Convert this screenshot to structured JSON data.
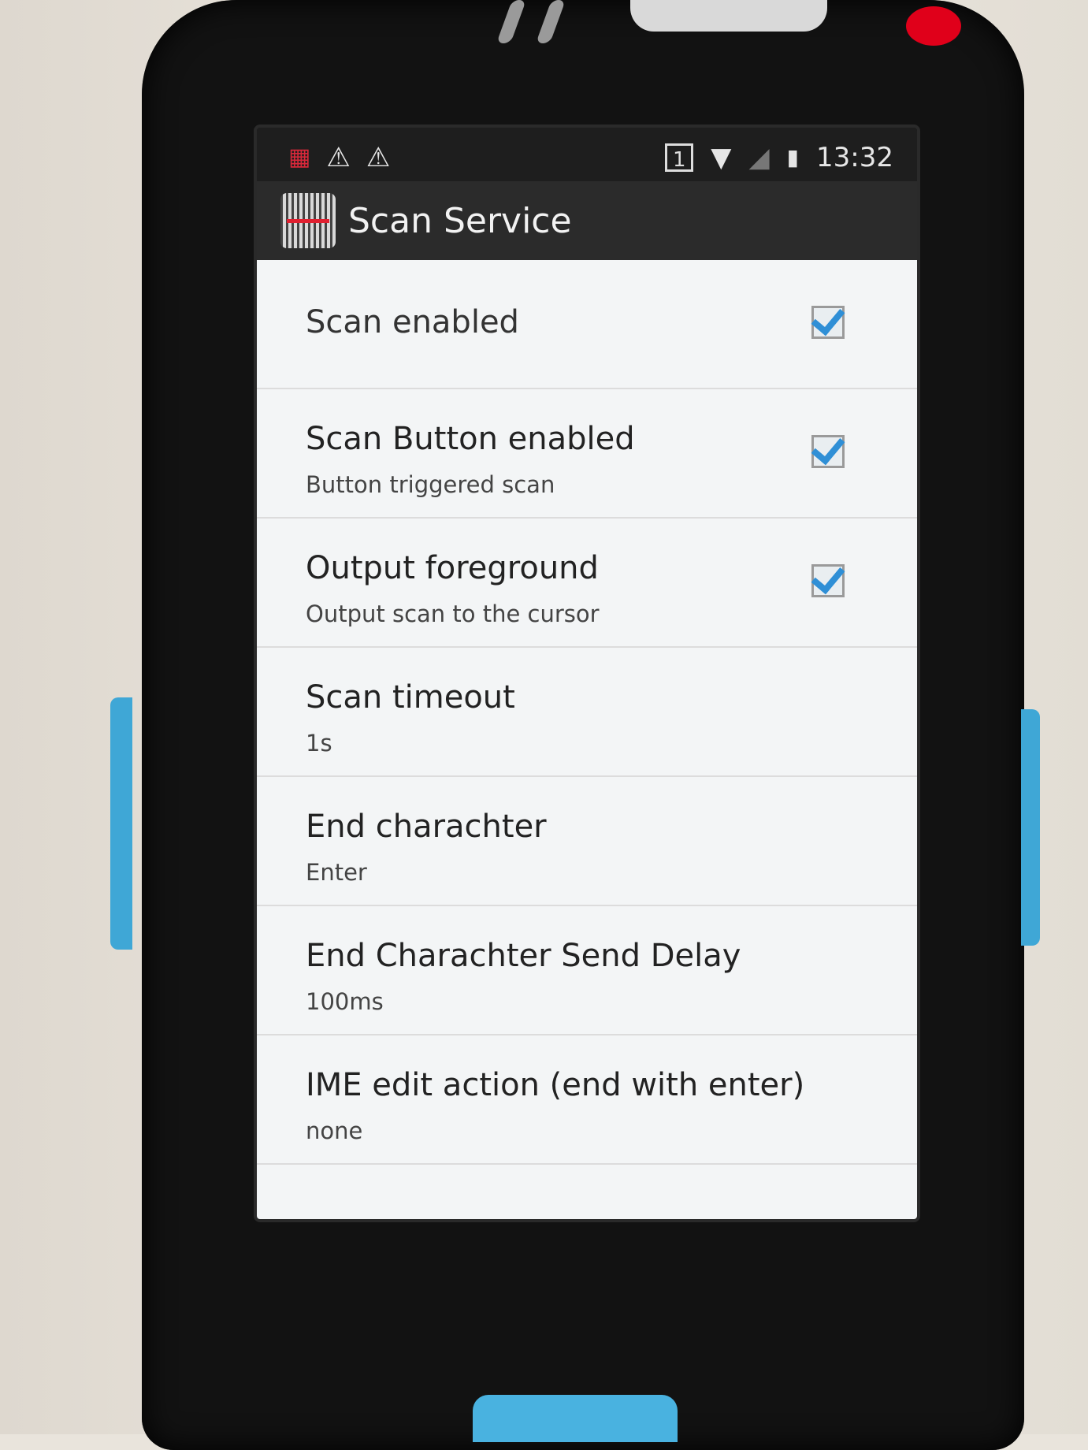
{
  "status_bar": {
    "time": "13:32",
    "sim_label": "1",
    "left_icons": [
      "barcode-notification-icon",
      "warning-icon",
      "warning-icon"
    ],
    "right_icons": [
      "sim-icon",
      "wifi-icon",
      "signal-icon",
      "battery-icon"
    ]
  },
  "action_bar": {
    "title": "Scan Service",
    "icon": "barcode-scanner-icon"
  },
  "preferences": [
    {
      "title": "Scan enabled",
      "summary": "",
      "checkbox": true,
      "checked": true
    },
    {
      "title": "Scan Button enabled",
      "summary": "Button triggered scan",
      "checkbox": true,
      "checked": true
    },
    {
      "title": "Output foreground",
      "summary": "Output scan to the cursor",
      "checkbox": true,
      "checked": true
    },
    {
      "title": "Scan timeout",
      "summary": "1s",
      "checkbox": false
    },
    {
      "title": "End charachter",
      "summary": "Enter",
      "checkbox": false
    },
    {
      "title": "End Charachter Send Delay",
      "summary": "100ms",
      "checkbox": false
    },
    {
      "title": "IME edit action (end with enter)",
      "summary": "none",
      "checkbox": false
    }
  ],
  "colors": {
    "checkmark": "#2f8fd6",
    "action_bar_bg": "#2b2b2b",
    "list_bg": "#f3f5f6"
  }
}
